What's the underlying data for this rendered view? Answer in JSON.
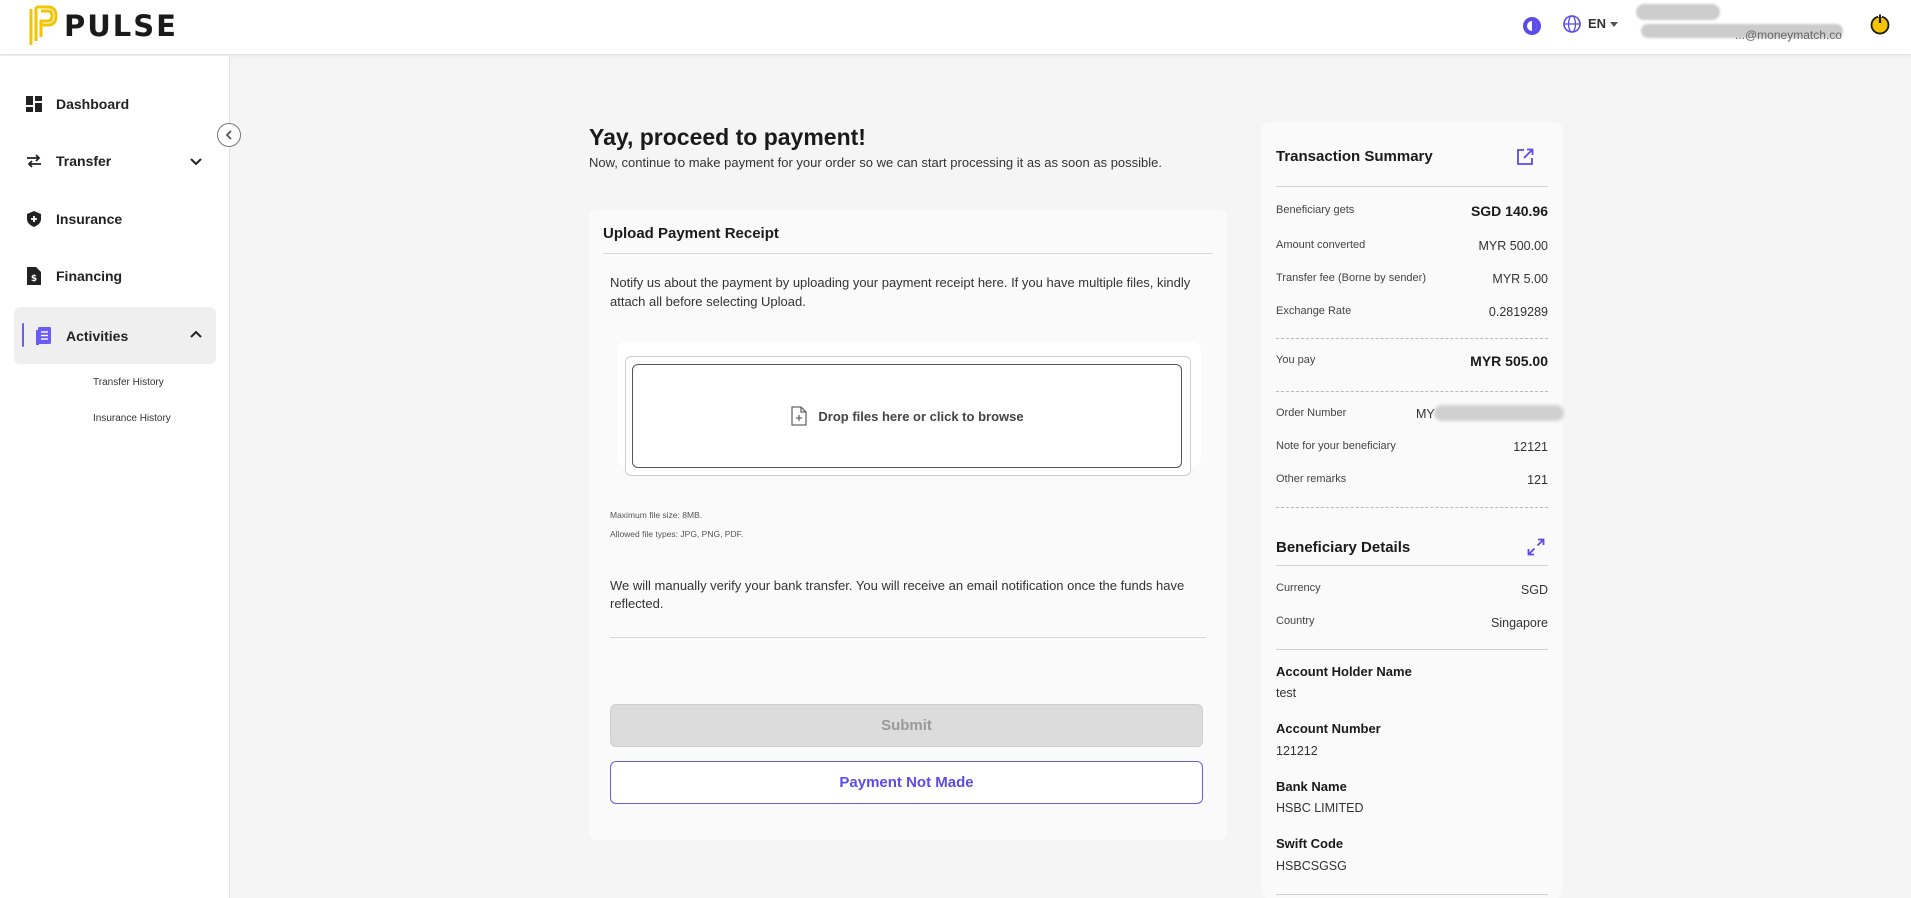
{
  "header": {
    "brand": "PULSE",
    "language": "EN",
    "user_email_partial": "...@moneymatch.co",
    "icons": [
      "pulse-logo-icon",
      "theme-toggle-icon",
      "globe-icon",
      "chevron-down-icon",
      "power-icon"
    ]
  },
  "sidebar": {
    "items": [
      {
        "label": "Dashboard",
        "icon": "dashboard-icon"
      },
      {
        "label": "Transfer",
        "icon": "transfer-icon"
      },
      {
        "label": "Insurance",
        "icon": "shield-icon"
      },
      {
        "label": "Financing",
        "icon": "document-dollar-icon"
      },
      {
        "label": "Activities",
        "icon": "receipt-icon"
      }
    ],
    "subitems": [
      "Transfer History",
      "Insurance History"
    ]
  },
  "main": {
    "title": "Yay, proceed to payment!",
    "subtitle": "Now, continue to make payment for your order so we can start processing it as as soon as possible.",
    "upload": {
      "title": "Upload Payment Receipt",
      "instructions": "Notify us about the payment by uploading your payment receipt here. If you have multiple files, kindly attach all before selecting Upload.",
      "drop_label": "Drop files here or click to browse",
      "max_size": "Maximum file size: 8MB.",
      "allowed_types": "Allowed file types: JPG, PNG, PDF.",
      "verify_note": "We will manually verify your bank transfer. You will receive an email notification once the funds have reflected.",
      "submit_label": "Submit",
      "not_made_label": "Payment Not Made"
    }
  },
  "summary": {
    "title": "Transaction Summary",
    "rows": [
      {
        "label": "Beneficiary gets",
        "value": "SGD 140.96"
      },
      {
        "label": "Amount converted",
        "value": "MYR 500.00"
      },
      {
        "label": "Transfer fee (Borne by sender)",
        "value": "MYR 5.00"
      },
      {
        "label": "Exchange Rate",
        "value": "0.2819289"
      }
    ],
    "you_pay": {
      "label": "You pay",
      "value": "MYR 505.00"
    },
    "order": {
      "label": "Order Number",
      "value": "MY"
    },
    "note": {
      "label": "Note for your beneficiary",
      "value": "12121"
    },
    "remarks": {
      "label": "Other remarks",
      "value": "121"
    },
    "beneficiary": {
      "title": "Beneficiary Details",
      "currency": {
        "label": "Currency",
        "value": "SGD"
      },
      "country": {
        "label": "Country",
        "value": "Singapore"
      },
      "account_holder": {
        "label": "Account Holder Name",
        "value": "test"
      },
      "account_number": {
        "label": "Account Number",
        "value": "121212"
      },
      "bank_name": {
        "label": "Bank Name",
        "value": "HSBC LIMITED"
      },
      "swift_code": {
        "label": "Swift Code",
        "value": "HSBCSGSG"
      }
    }
  },
  "colors": {
    "accent": "#5b4bea",
    "brand_yellow": "#f5c400",
    "page_bg": "#f5f5f5"
  }
}
